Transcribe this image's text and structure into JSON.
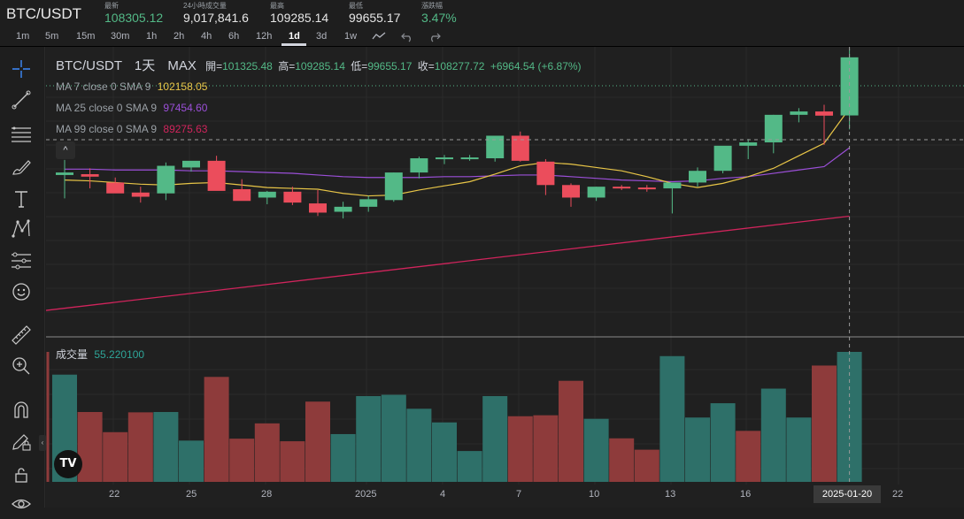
{
  "header": {
    "symbol": "BTC/USDT",
    "stats": [
      {
        "label": "最新",
        "value": "108305.12",
        "color": "#53b987"
      },
      {
        "label": "24小時成交量",
        "value": "9,017,841.6",
        "color": "#e6e6e6"
      },
      {
        "label": "最高",
        "value": "109285.14",
        "color": "#e6e6e6"
      },
      {
        "label": "最低",
        "value": "99655.17",
        "color": "#e6e6e6"
      },
      {
        "label": "漲跌幅",
        "value": "3.47%",
        "color": "#53b987"
      }
    ]
  },
  "timeframes": {
    "items": [
      "1m",
      "5m",
      "15m",
      "30m",
      "1h",
      "2h",
      "4h",
      "6h",
      "12h",
      "1d",
      "3d",
      "1w"
    ],
    "active": "1d"
  },
  "toolbar_icons": [
    "crosshair-icon",
    "trend-line-icon",
    "fib-icon",
    "brush-icon",
    "text-icon",
    "pattern-icon",
    "prediction-icon",
    "emoji-icon",
    "ruler-icon",
    "zoom-in-icon",
    "magnet-icon",
    "edit-lock-icon",
    "lock-icon",
    "eye-icon"
  ],
  "legend": {
    "title": "BTC/USDT",
    "interval": "1天",
    "range": "MAX",
    "open_label": "開=",
    "open": "101325.48",
    "high_label": "高=",
    "high": "109285.14",
    "low_label": "低=",
    "low": "99655.17",
    "close_label": "收=",
    "close": "108277.72",
    "change": "+6964.54 (+6.87%)",
    "ma": [
      {
        "label": "MA 7 close 0 SMA 9",
        "value": "102158.05",
        "color": "#e8c547"
      },
      {
        "label": "MA 25 close 0 SMA 9",
        "value": "97454.60",
        "color": "#9b4fd8"
      },
      {
        "label": "MA 99 close 0 SMA 9",
        "value": "89275.63",
        "color": "#d1245c"
      }
    ],
    "collapse": "^"
  },
  "volume": {
    "label": "成交量",
    "value": "55.220100"
  },
  "x_axis": {
    "labels": [
      "22",
      "25",
      "28",
      "2025",
      "4",
      "7",
      "10",
      "13",
      "16",
      "22"
    ],
    "crosshair_date": "2025-01-20"
  },
  "logo": "TV",
  "colors": {
    "up": "#53b987",
    "down": "#eb4d5c",
    "vol_up": "#2e7069",
    "vol_down": "#8e3b3b",
    "ma7": "#e8c547",
    "ma25": "#9b4fd8",
    "ma99": "#d1245c"
  },
  "chart_data": {
    "type": "candlestick",
    "interval": "1d",
    "series": [
      {
        "open": 94200,
        "high": 96000,
        "low": 91400,
        "close": 94500
      },
      {
        "open": 94300,
        "high": 95000,
        "low": 92600,
        "close": 94000
      },
      {
        "open": 93300,
        "high": 93900,
        "low": 92300,
        "close": 92000
      },
      {
        "open": 92100,
        "high": 92800,
        "low": 90900,
        "close": 91600
      },
      {
        "open": 92000,
        "high": 95700,
        "low": 91200,
        "close": 95300
      },
      {
        "open": 95100,
        "high": 95600,
        "low": 94600,
        "close": 95900
      },
      {
        "open": 95900,
        "high": 96500,
        "low": 92500,
        "close": 92300
      },
      {
        "open": 92500,
        "high": 93700,
        "low": 91500,
        "close": 91100
      },
      {
        "open": 91500,
        "high": 92300,
        "low": 90700,
        "close": 92200
      },
      {
        "open": 92200,
        "high": 92800,
        "low": 90600,
        "close": 90900
      },
      {
        "open": 90800,
        "high": 92400,
        "low": 89300,
        "close": 89700
      },
      {
        "open": 89800,
        "high": 91000,
        "low": 89000,
        "close": 90400
      },
      {
        "open": 90400,
        "high": 91700,
        "low": 89800,
        "close": 91300
      },
      {
        "open": 91200,
        "high": 94500,
        "low": 91000,
        "close": 94500
      },
      {
        "open": 94500,
        "high": 96400,
        "low": 93800,
        "close": 96200
      },
      {
        "open": 96200,
        "high": 96600,
        "low": 95500,
        "close": 96300
      },
      {
        "open": 96300,
        "high": 96600,
        "low": 95900,
        "close": 96300
      },
      {
        "open": 96200,
        "high": 98800,
        "low": 95800,
        "close": 98900
      },
      {
        "open": 98900,
        "high": 99400,
        "low": 95800,
        "close": 95900
      },
      {
        "open": 95800,
        "high": 96100,
        "low": 91800,
        "close": 93000
      },
      {
        "open": 93000,
        "high": 93200,
        "low": 90400,
        "close": 91500
      },
      {
        "open": 91500,
        "high": 92800,
        "low": 91100,
        "close": 92800
      },
      {
        "open": 92800,
        "high": 93000,
        "low": 92400,
        "close": 92700
      },
      {
        "open": 92700,
        "high": 93000,
        "low": 92200,
        "close": 92600
      },
      {
        "open": 92600,
        "high": 92900,
        "low": 89600,
        "close": 93300
      },
      {
        "open": 93300,
        "high": 95100,
        "low": 92800,
        "close": 94700
      },
      {
        "open": 94700,
        "high": 97600,
        "low": 94400,
        "close": 97700
      },
      {
        "open": 97700,
        "high": 98500,
        "low": 96100,
        "close": 98100
      },
      {
        "open": 98100,
        "high": 101400,
        "low": 96800,
        "close": 101400
      },
      {
        "open": 101400,
        "high": 102200,
        "low": 100500,
        "close": 101800
      },
      {
        "open": 101800,
        "high": 102600,
        "low": 97800,
        "close": 101300
      },
      {
        "open": 101325.48,
        "high": 109285.14,
        "low": 99655.17,
        "close": 108277.72
      }
    ],
    "ma7": [
      93600,
      93500,
      93300,
      93100,
      93000,
      93200,
      93300,
      93000,
      92700,
      92600,
      92500,
      92000,
      91700,
      91800,
      92400,
      92900,
      93400,
      94300,
      95300,
      95700,
      95500,
      95100,
      94700,
      94000,
      93200,
      92700,
      93200,
      94000,
      95000,
      96500,
      98000,
      102158.05
    ],
    "ma25": [
      94900,
      94900,
      94800,
      94800,
      94800,
      94700,
      94700,
      94600,
      94500,
      94400,
      94200,
      94000,
      93900,
      93900,
      93900,
      94000,
      94000,
      94100,
      94200,
      94200,
      94000,
      93800,
      93600,
      93500,
      93400,
      93500,
      93800,
      94000,
      94400,
      94800,
      95200,
      97454.6
    ],
    "ma99_start": 78000,
    "ma99_end": 89275.63,
    "volume": [
      33,
      21.5,
      15.3,
      21.4,
      21.5,
      12.7,
      32.3,
      13.3,
      18,
      12.5,
      24.7,
      14.7,
      26.4,
      26.8,
      22.5,
      18.3,
      9.5,
      26.4,
      20.2,
      20.5,
      31.1,
      19.4,
      13.4,
      9.9,
      38.7,
      19.8,
      24.2,
      15.7,
      28.7,
      19.8,
      35.8,
      40.0
    ],
    "vol_dir": [
      1,
      0,
      0,
      0,
      1,
      1,
      0,
      0,
      0,
      0,
      0,
      1,
      1,
      1,
      1,
      1,
      1,
      1,
      0,
      0,
      0,
      1,
      0,
      0,
      1,
      1,
      1,
      0,
      1,
      1,
      0,
      1
    ]
  }
}
